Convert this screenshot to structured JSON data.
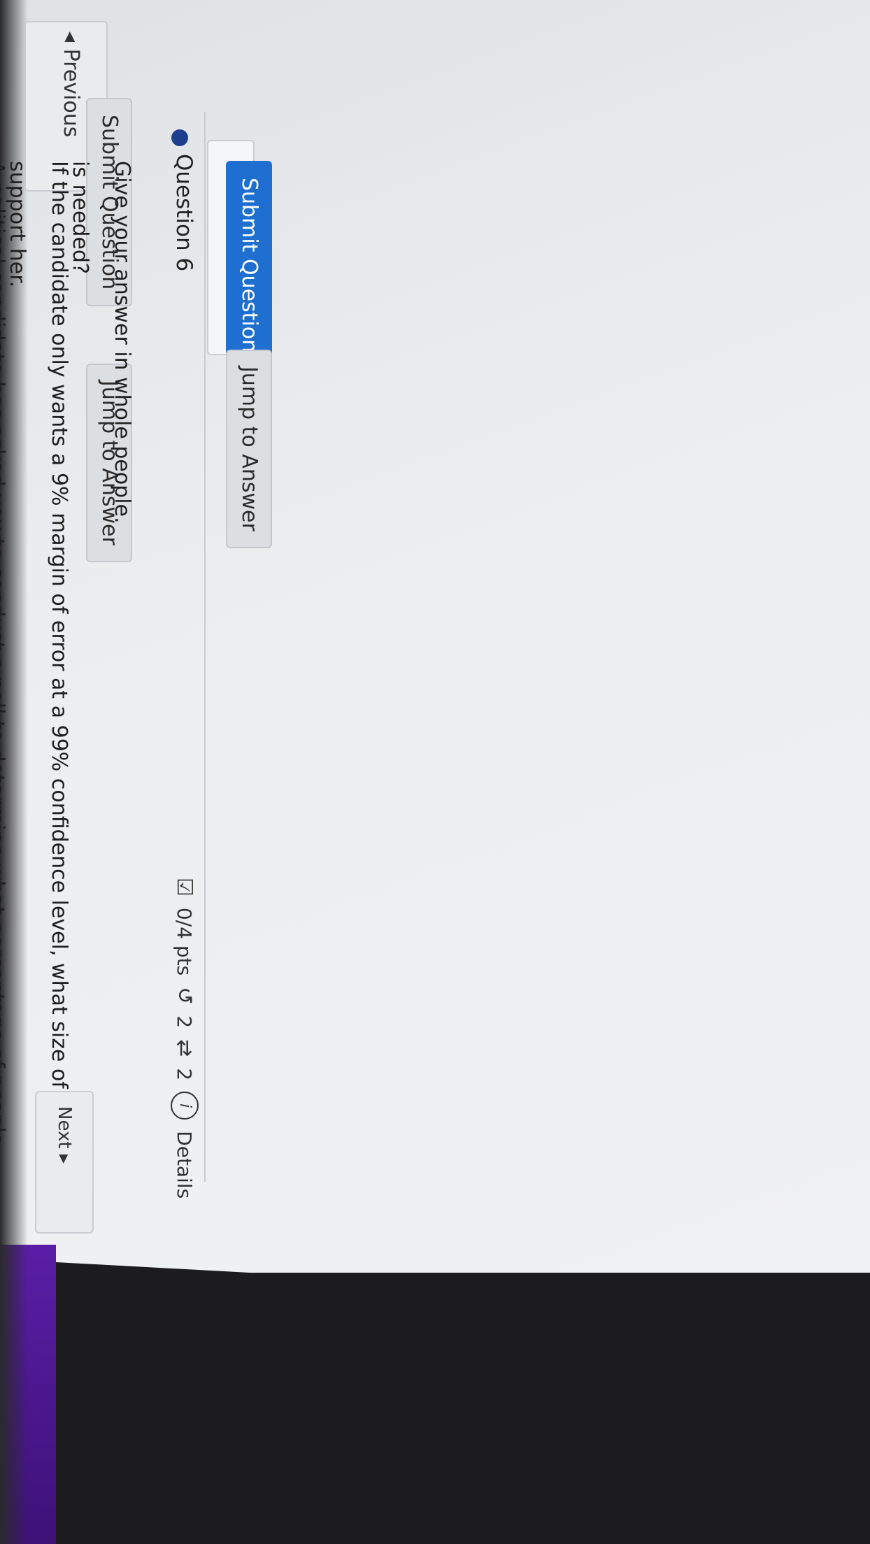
{
  "toolbar": {
    "submit_label": "Submit Question",
    "jump_label": "Jump to Answer"
  },
  "question": {
    "title": "Question 6",
    "points": "0/4 pts",
    "retries": "2",
    "attempts": "2",
    "details_label": "Details",
    "prompt_line1": "A political candidate has asked you to conduct a poll to determine what percentage of people",
    "prompt_line2": "support her.",
    "ask_line1": "If the candidate only wants a 9% margin of error at a 99% confidence level, what size of sample",
    "ask_line2": "is needed?",
    "instruction": "Give your answer in whole people.",
    "answer_value": ""
  },
  "actions": {
    "submit_label": "Submit Question",
    "jump_label": "Jump to Answer"
  },
  "nav": {
    "previous_label": "◂ Previous",
    "next_label": "Next ▸"
  },
  "icons": {
    "checkbox": "check-icon",
    "pts": "score-icon",
    "retry": "retry-icon",
    "attempts": "attempts-icon",
    "info": "info-icon"
  }
}
